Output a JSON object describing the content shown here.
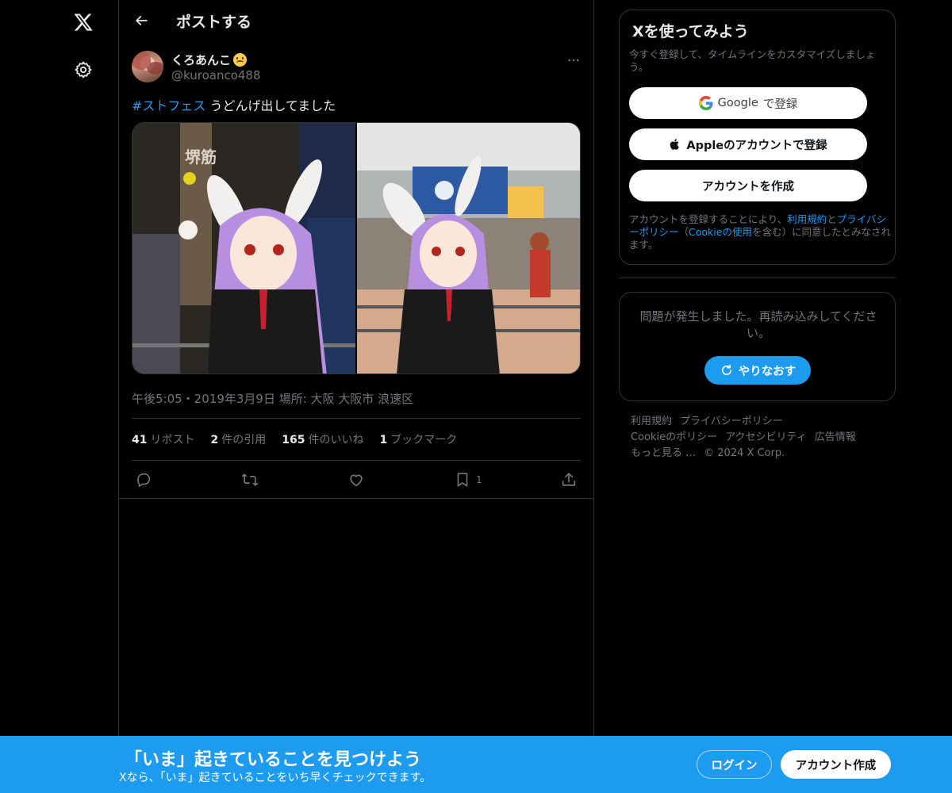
{
  "header": {
    "title": "ポストする"
  },
  "post": {
    "author_name": "くろあんこ",
    "author_handle": "@kuroanco488",
    "hashtag": "#ストフェス",
    "text": " うどんげ出してました",
    "meta": "午後5:05・2019年3月9日 場所: 大阪 大阪市 浪速区",
    "stats": {
      "reposts_count": "41",
      "reposts_label": "リポスト",
      "quotes_count": "2",
      "quotes_label": "件の引用",
      "likes_count": "165",
      "likes_label": "件のいいね",
      "bookmarks_count": "1",
      "bookmarks_label": "ブックマーク"
    },
    "actions": {
      "bookmark_count": "1"
    },
    "photo_sign_text": "堺筋"
  },
  "sidebar": {
    "signup": {
      "title": "Xを使ってみよう",
      "subtitle": "今すぐ登録して、タイムラインをカスタマイズしましょう。",
      "google_brand": "Google",
      "google_suffix": " で登録",
      "apple_label": "Appleのアカウントで登録",
      "create_label": "アカウントを作成",
      "legal_prefix": "アカウントを登録することにより、",
      "legal_terms": "利用規約",
      "legal_and": "と",
      "legal_privacy": "プライバシーポリシー",
      "legal_open": "（",
      "legal_cookie": "Cookieの使用",
      "legal_suffix": "を含む）に同意したとみなされます。"
    },
    "error": {
      "message": "問題が発生しました。再読み込みしてください。",
      "retry_label": "やりなおす"
    },
    "footer": {
      "terms": "利用規約",
      "privacy": "プライバシーポリシー",
      "cookie": "Cookieのポリシー",
      "accessibility": "アクセシビリティ",
      "ads": "広告情報",
      "more": "もっと見る …",
      "copyright": "© 2024 X Corp."
    }
  },
  "bottom_bar": {
    "title": "「いま」起きていることを見つけよう",
    "subtitle": "Xなら、「いま」起きていることをいち早くチェックできます。",
    "login_label": "ログイン",
    "create_label": "アカウント作成"
  },
  "colors": {
    "accent": "#1d9bf0",
    "background": "#000000",
    "border": "#2f3336",
    "muted": "#71767b"
  }
}
